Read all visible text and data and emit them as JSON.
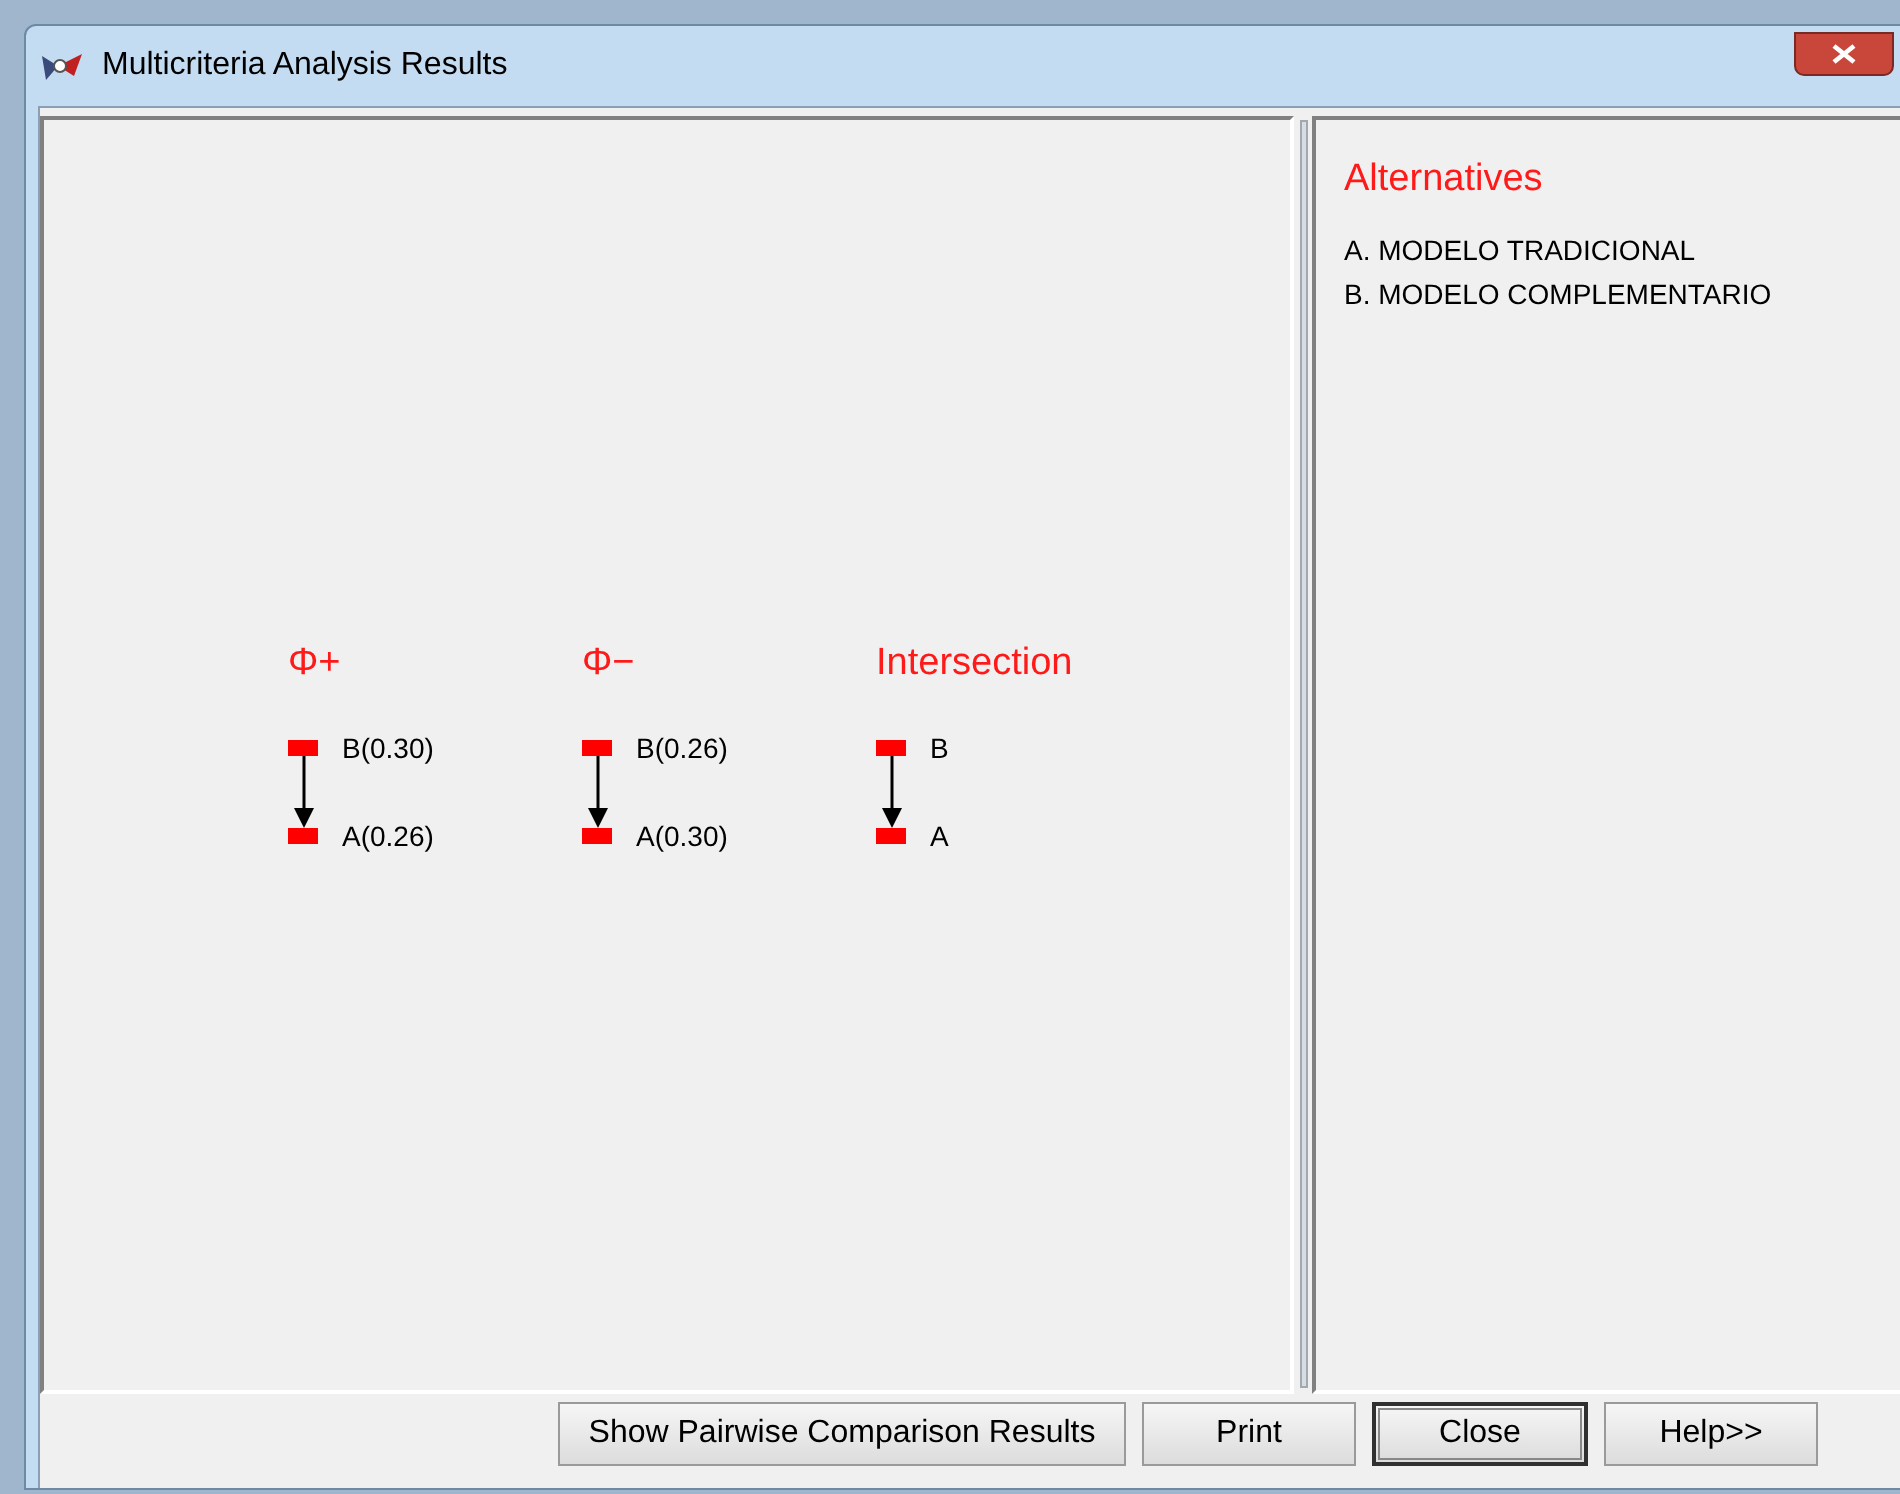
{
  "window": {
    "title": "Multicriteria Analysis Results"
  },
  "diagrams": [
    {
      "title": "Φ+",
      "nodes": [
        "B(0.30)",
        "A(0.26)"
      ]
    },
    {
      "title": "Φ−",
      "nodes": [
        "B(0.26)",
        "A(0.30)"
      ]
    },
    {
      "title": "Intersection",
      "nodes": [
        "B",
        "A"
      ]
    }
  ],
  "alternatives": {
    "title": "Alternatives",
    "items": [
      "A. MODELO TRADICIONAL",
      "B. MODELO COMPLEMENTARIO"
    ]
  },
  "buttons": [
    {
      "label": "Show Pairwise Comparison Results",
      "default": false
    },
    {
      "label": "Print",
      "default": false
    },
    {
      "label": "Close",
      "default": true
    },
    {
      "label": "Help>>",
      "default": false
    }
  ]
}
